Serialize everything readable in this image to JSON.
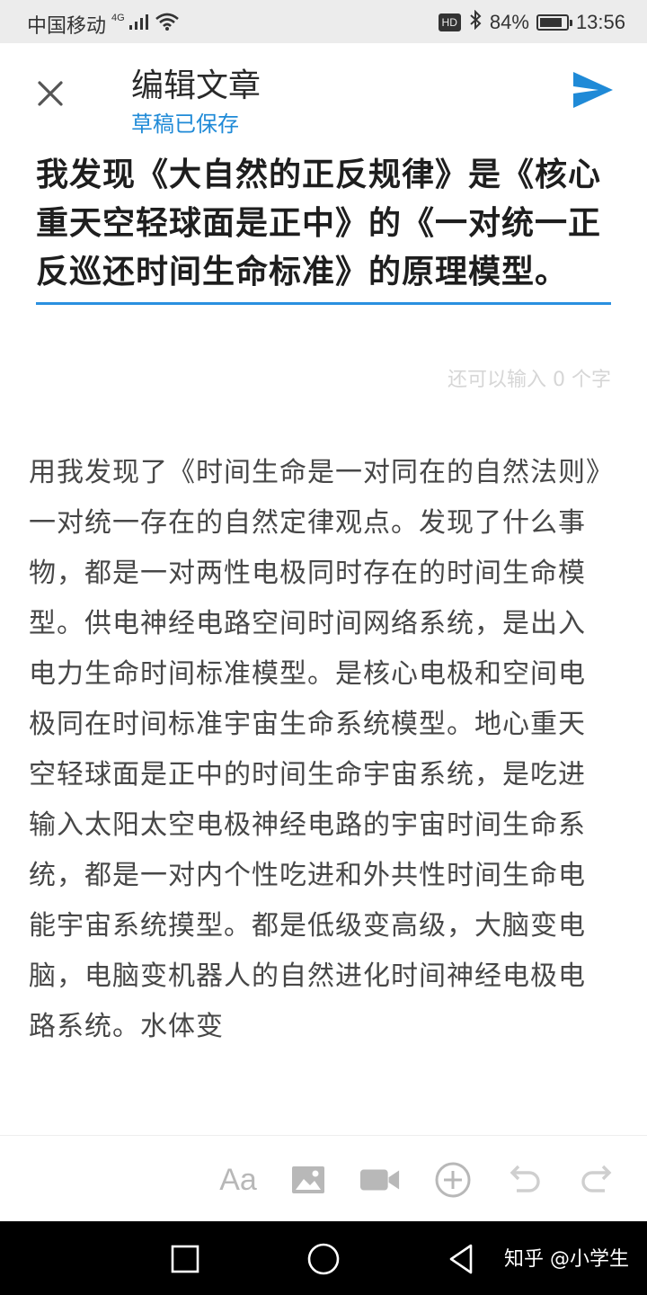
{
  "status_bar": {
    "carrier": "中国移动",
    "network": "4G",
    "hd_badge": "HD",
    "battery_percent_text": "84%",
    "battery_level": 0.84,
    "time": "13:56"
  },
  "header": {
    "title": "编辑文章",
    "subtitle": "草稿已保存",
    "close_icon": "close-icon",
    "send_icon": "send-icon",
    "accent_color": "#1f8ad7"
  },
  "article": {
    "title": "我发现《大自然的正反规律》是《核心重天空轻球面是正中》的《一对统一正反巡还时间生命标准》的原理模型。",
    "remaining_chars": "还可以输入 0 个字",
    "body": "用我发现了《时间生命是一对同在的自然法则》一对统一存在的自然定律观点。发现了什么事物，都是一对两性电极同时存在的时间生命模型。供电神经电路空间时间网络系统，是出入电力生命时间标准模型。是核心电极和空间电极同在时间标准宇宙生命系统模型。地心重天空轻球面是正中的时间生命宇宙系统，是吃进输入太阳太空电极神经电路的宇宙时间生命系统，都是一对内个性吃进和外共性时间生命电能宇宙系统摸型。都是低级变高级，大脑变电脑，电脑变机器人的自然进化时间神经电极电路系统。水体变"
  },
  "toolbar": {
    "text_format_label": "Aa",
    "items": [
      "text-format-icon",
      "image-icon",
      "video-icon",
      "add-circle-icon",
      "undo-icon",
      "redo-icon"
    ]
  },
  "nav_bar": {
    "watermark": "知乎 @小学生"
  }
}
